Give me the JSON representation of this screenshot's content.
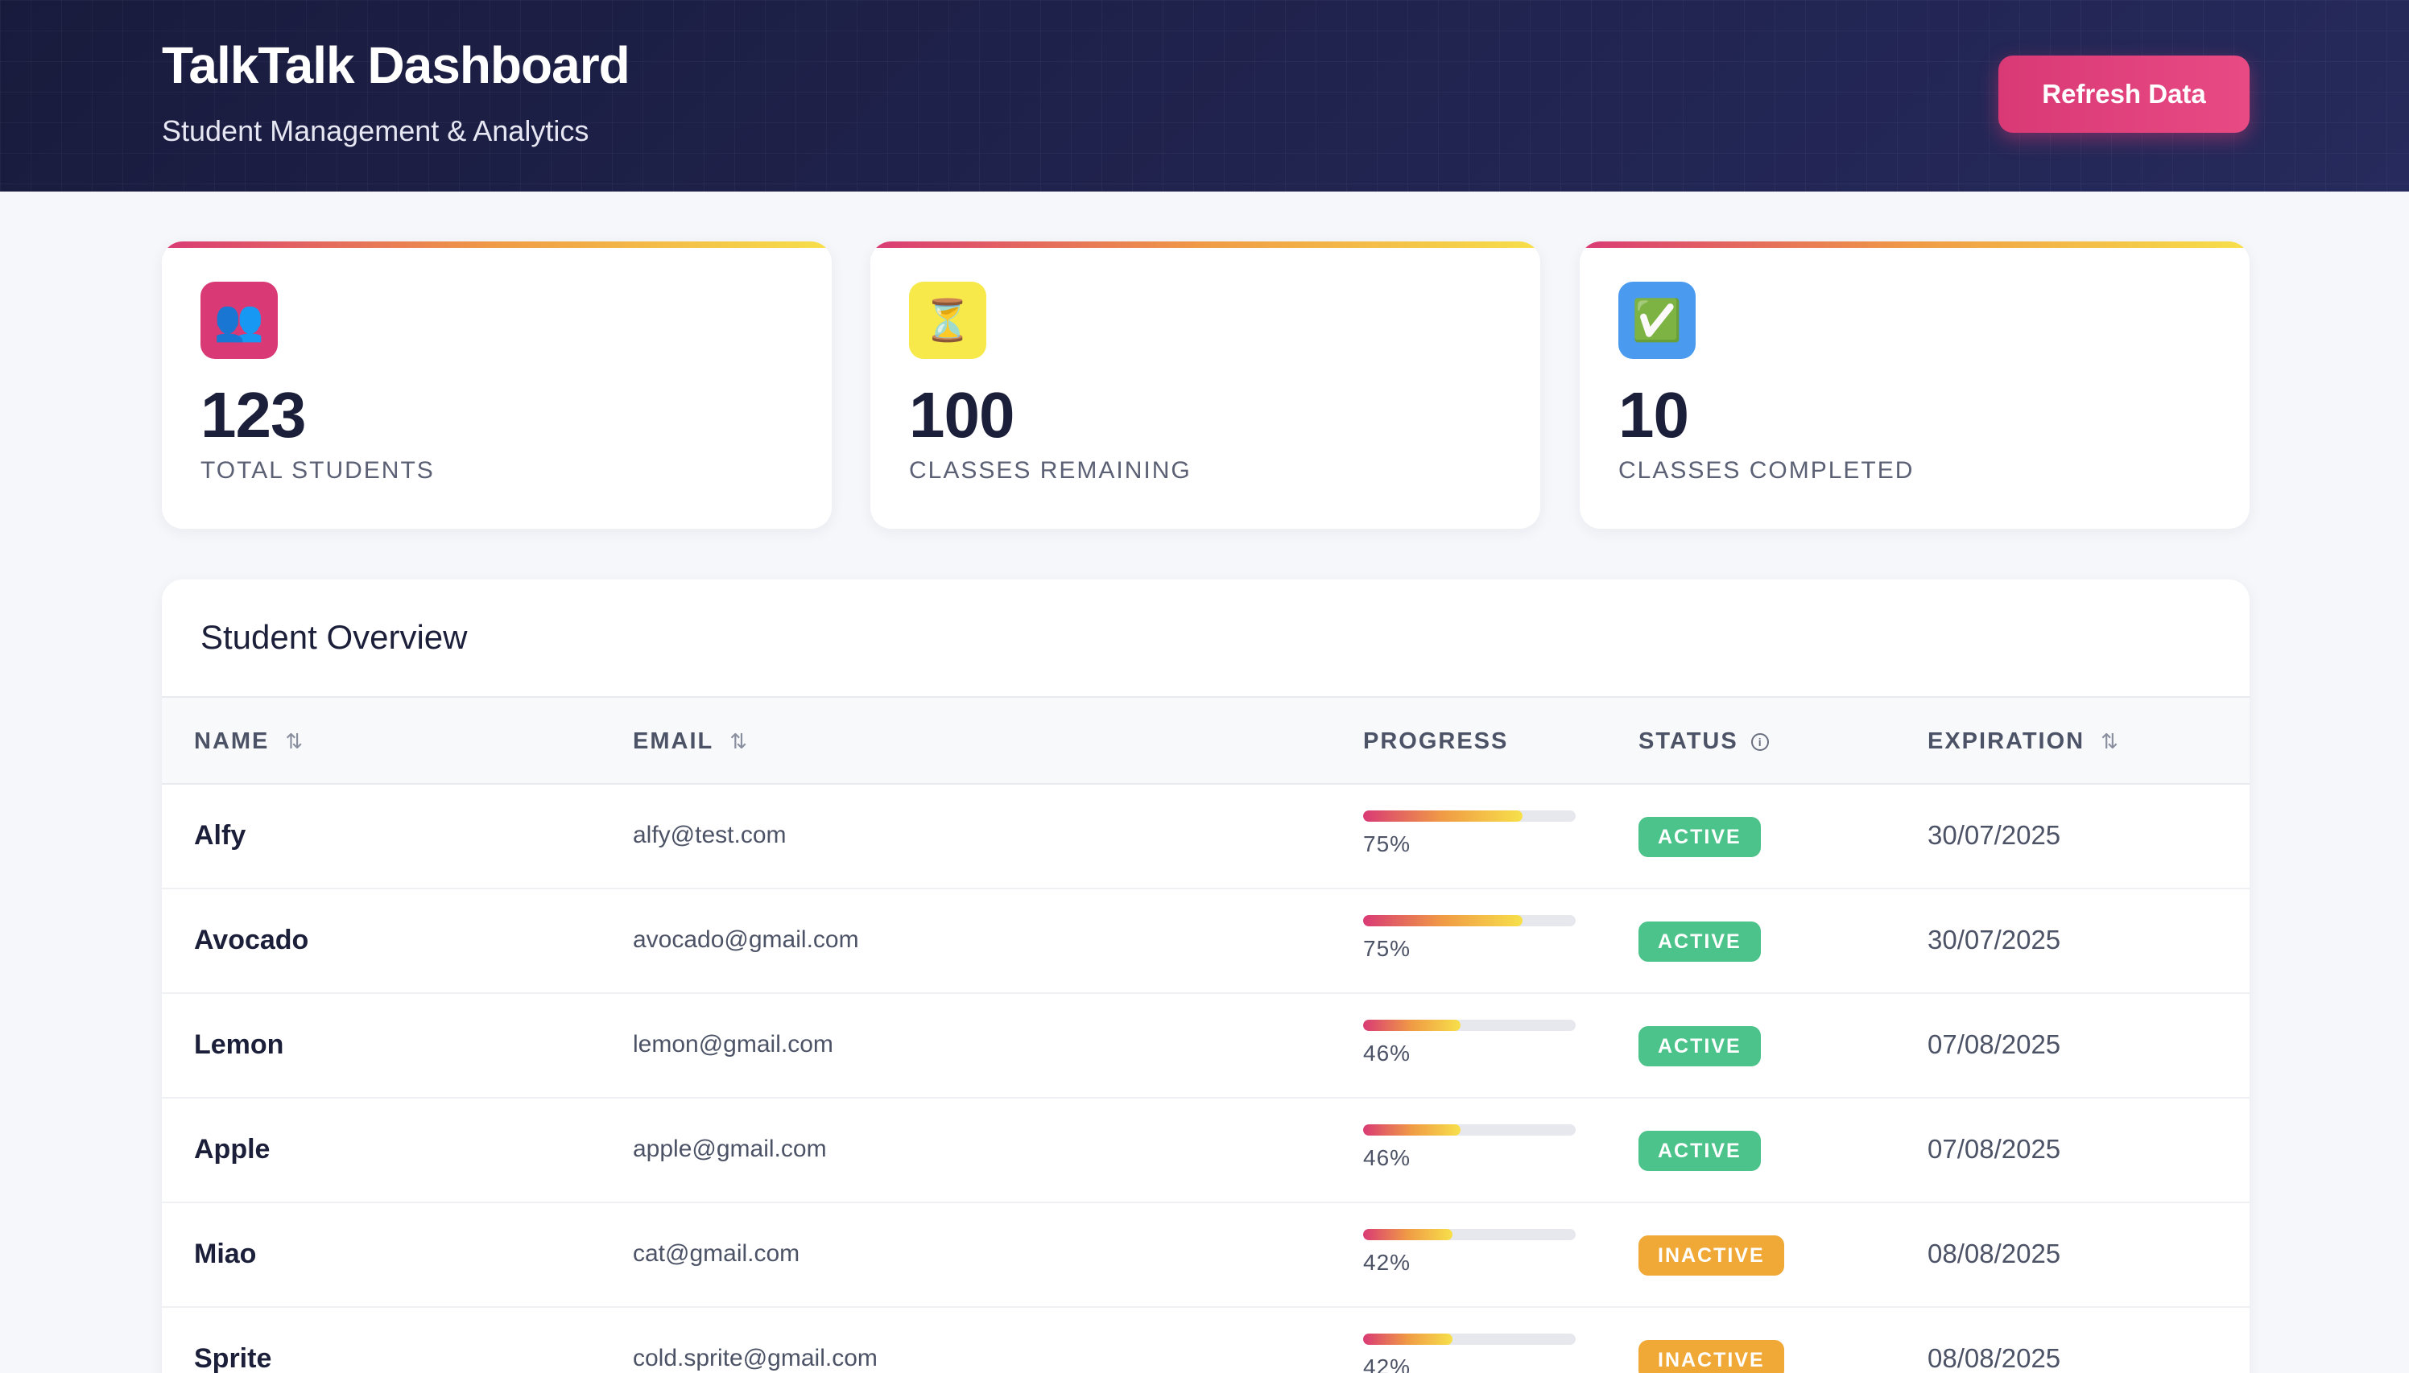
{
  "header": {
    "title": "TalkTalk Dashboard",
    "subtitle": "Student Management & Analytics",
    "refresh_label": "Refresh Data",
    "accent": "#d93a75",
    "background": "#1d1f45"
  },
  "stats": [
    {
      "icon": "users-icon",
      "glyph": "👥",
      "value": "123",
      "label": "TOTAL STUDENTS",
      "icon_bg": "#d93a75"
    },
    {
      "icon": "hourglass-icon",
      "glyph": "⏳",
      "value": "100",
      "label": "CLASSES REMAINING",
      "icon_bg": "#f7e94a"
    },
    {
      "icon": "check-icon",
      "glyph": "✅",
      "value": "10",
      "label": "CLASSES COMPLETED",
      "icon_bg": "#4a9bf0"
    }
  ],
  "overview": {
    "title": "Student Overview",
    "columns": {
      "name": "NAME",
      "email": "EMAIL",
      "progress": "PROGRESS",
      "status": "STATUS",
      "expiration": "EXPIRATION"
    },
    "sort_icon": "⇅",
    "info_icon": "i",
    "rows": [
      {
        "name": "Alfy",
        "email": "alfy@test.com",
        "progress": 75,
        "progress_label": "75%",
        "status": "ACTIVE",
        "expiration": "30/07/2025"
      },
      {
        "name": "Avocado",
        "email": "avocado@gmail.com",
        "progress": 75,
        "progress_label": "75%",
        "status": "ACTIVE",
        "expiration": "30/07/2025"
      },
      {
        "name": "Lemon",
        "email": "lemon@gmail.com",
        "progress": 46,
        "progress_label": "46%",
        "status": "ACTIVE",
        "expiration": "07/08/2025"
      },
      {
        "name": "Apple",
        "email": "apple@gmail.com",
        "progress": 46,
        "progress_label": "46%",
        "status": "ACTIVE",
        "expiration": "07/08/2025"
      },
      {
        "name": "Miao",
        "email": "cat@gmail.com",
        "progress": 42,
        "progress_label": "42%",
        "status": "INACTIVE",
        "expiration": "08/08/2025"
      },
      {
        "name": "Sprite",
        "email": "cold.sprite@gmail.com",
        "progress": 42,
        "progress_label": "42%",
        "status": "INACTIVE",
        "expiration": "08/08/2025"
      }
    ]
  },
  "colors": {
    "active": "#4cc38a",
    "inactive": "#f0a837"
  }
}
